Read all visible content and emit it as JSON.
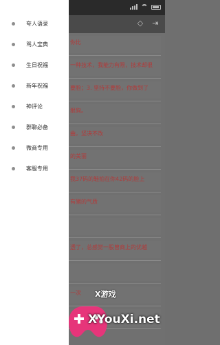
{
  "drawer": {
    "items": [
      {
        "label": "夸人语录"
      },
      {
        "label": "骂人宝典"
      },
      {
        "label": "生日祝福"
      },
      {
        "label": "新年祝福"
      },
      {
        "label": "神评论"
      },
      {
        "label": "群聊必备"
      },
      {
        "label": "微商专用"
      },
      {
        "label": "客服专用"
      }
    ]
  },
  "list": {
    "rows": [
      {
        "text": "你比"
      },
      {
        "text": "一种技术，我能力有限，技术却很"
      },
      {
        "text": "要脸；3. 坚持不要脸，你做到了"
      },
      {
        "text": "狠狗。"
      },
      {
        "text": "曲，坚决不改"
      },
      {
        "text": "的美丽"
      },
      {
        "text": "我37码的鞋拍在你42码的脸上"
      },
      {
        "text": "有猪的气质"
      },
      {
        "text": ""
      },
      {
        "text": "透了，总感觉一股曾商上的优越"
      },
      {
        "text": ""
      },
      {
        "text": "一次"
      },
      {
        "text": "孤独"
      },
      {
        "text": "你是魔力法有什么用"
      }
    ]
  },
  "watermark": {
    "title": "X游戏",
    "domain": "XYouXi.net"
  },
  "colors": {
    "drawer_bg": "#ffffff",
    "overlay": "#707070",
    "list_text": "#b23a3a"
  }
}
